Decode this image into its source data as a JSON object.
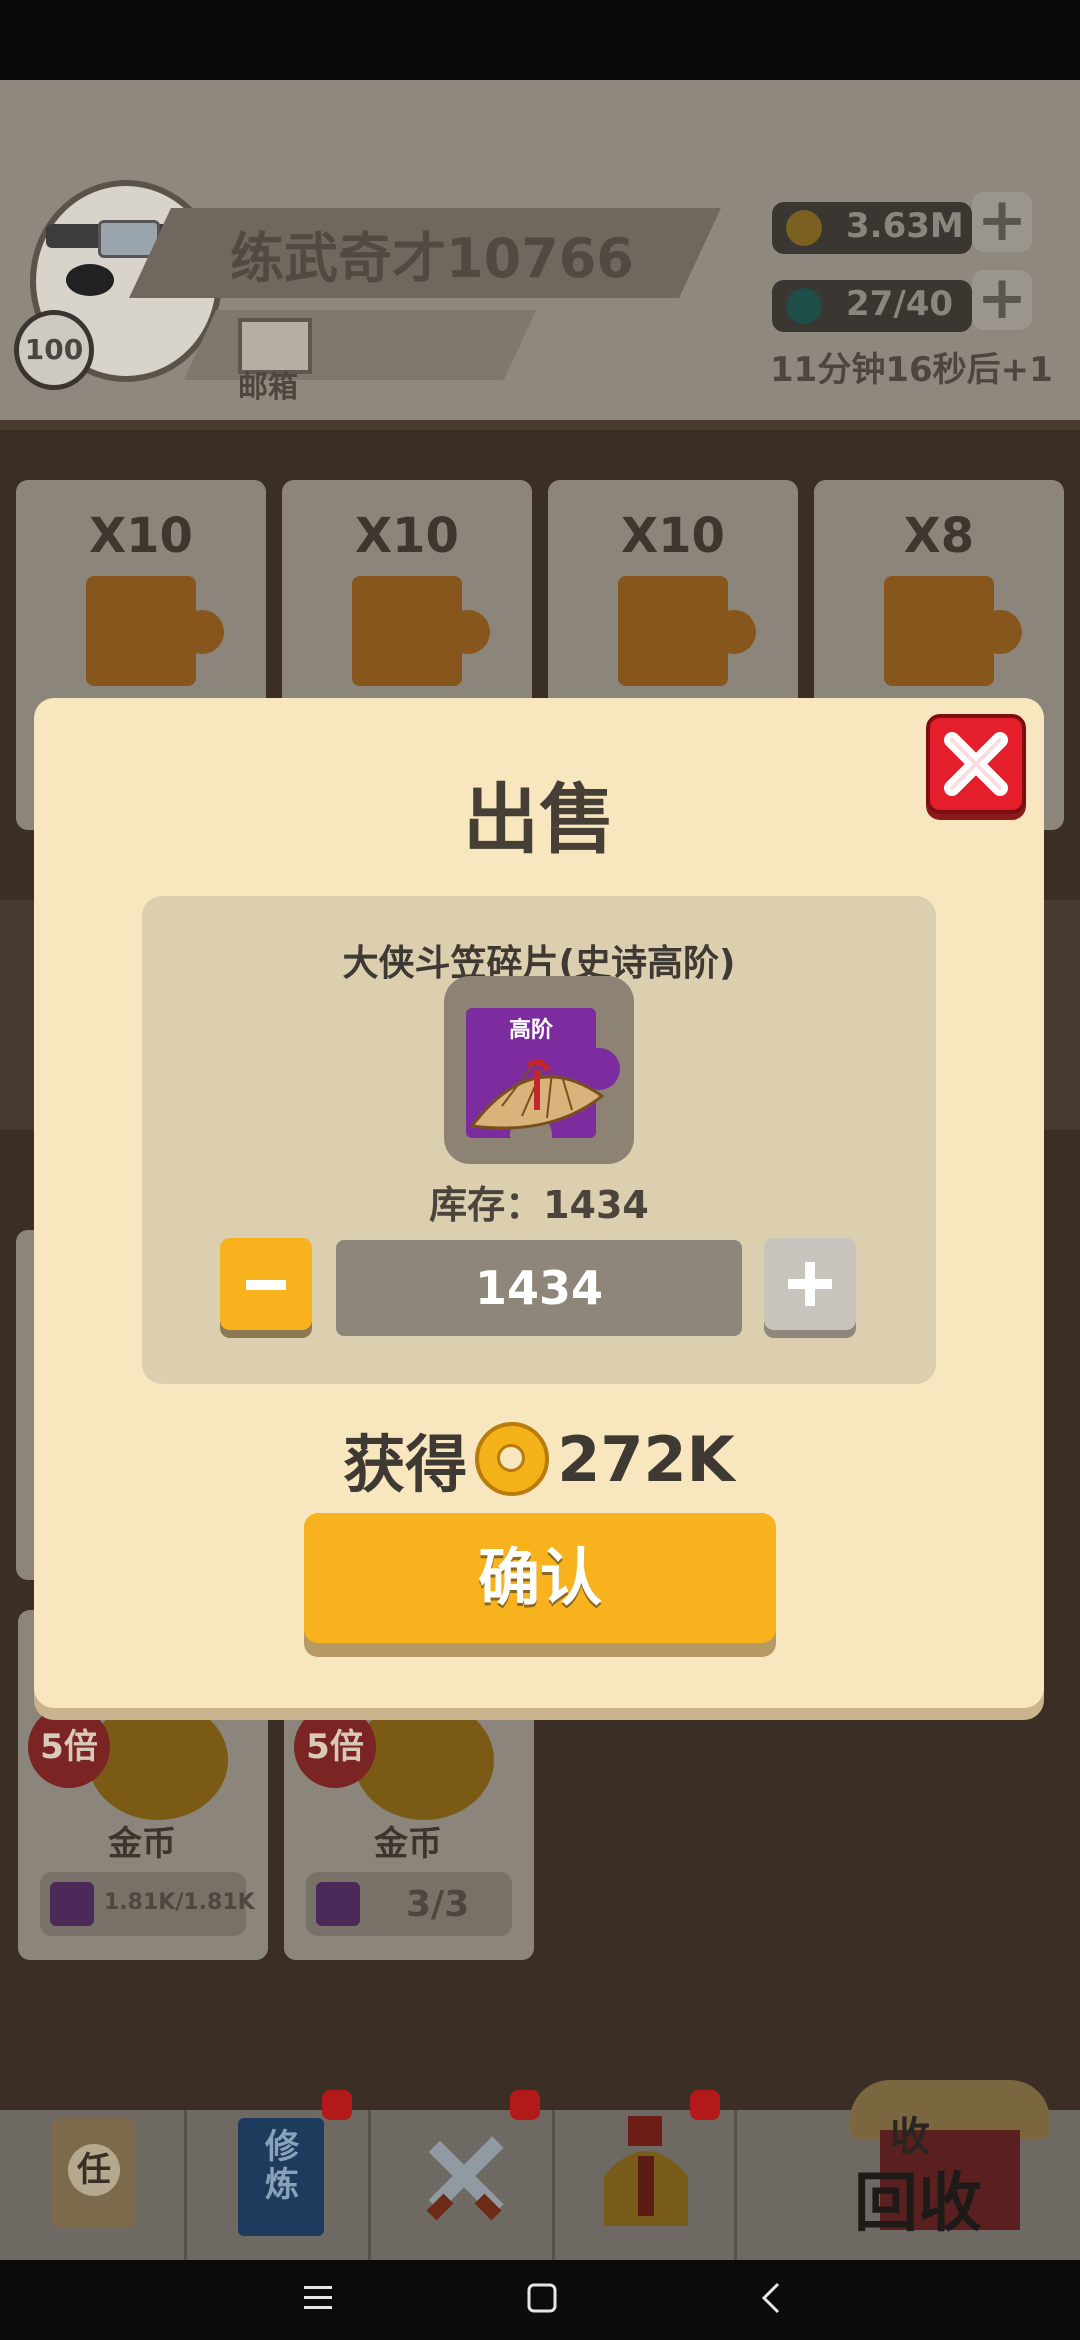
{
  "header": {
    "player_name": "练武奇才10766",
    "level": "100",
    "mail_label": "邮箱",
    "gold": "3.63M",
    "stamina": "27/40",
    "timer_text": "11分钟16秒后+1"
  },
  "shop": {
    "cards": [
      {
        "count": "X10"
      },
      {
        "count": "X10"
      },
      {
        "count": "X10"
      },
      {
        "count": "X8"
      }
    ],
    "bottom_cards": [
      {
        "badge": "5倍",
        "label": "金币",
        "progress": "1.81K/1.81K"
      },
      {
        "badge": "5倍",
        "label": "金币",
        "progress": "3/3"
      }
    ]
  },
  "nav": {
    "task_icon_text": "任",
    "train_icon_text": "修炼",
    "recycle_top": "收",
    "recycle_label": "回收"
  },
  "modal": {
    "title": "出售",
    "item_name": "大侠斗笠碎片(史诗高阶)",
    "tier_tag": "高阶",
    "stock": "库存：1434",
    "quantity": "1434",
    "gain_label": "获得",
    "gain_value": "272K",
    "confirm_label": "确认"
  },
  "colors": {
    "modal_bg": "#f8e6bf",
    "accent_orange": "#f7b21e",
    "close_red": "#e41e2a",
    "item_purple": "#7d2ca0"
  },
  "icons": [
    "close-icon",
    "minus-icon",
    "plus-icon",
    "coin-icon",
    "mail-icon",
    "back-icon",
    "home-icon",
    "menu-icon"
  ]
}
